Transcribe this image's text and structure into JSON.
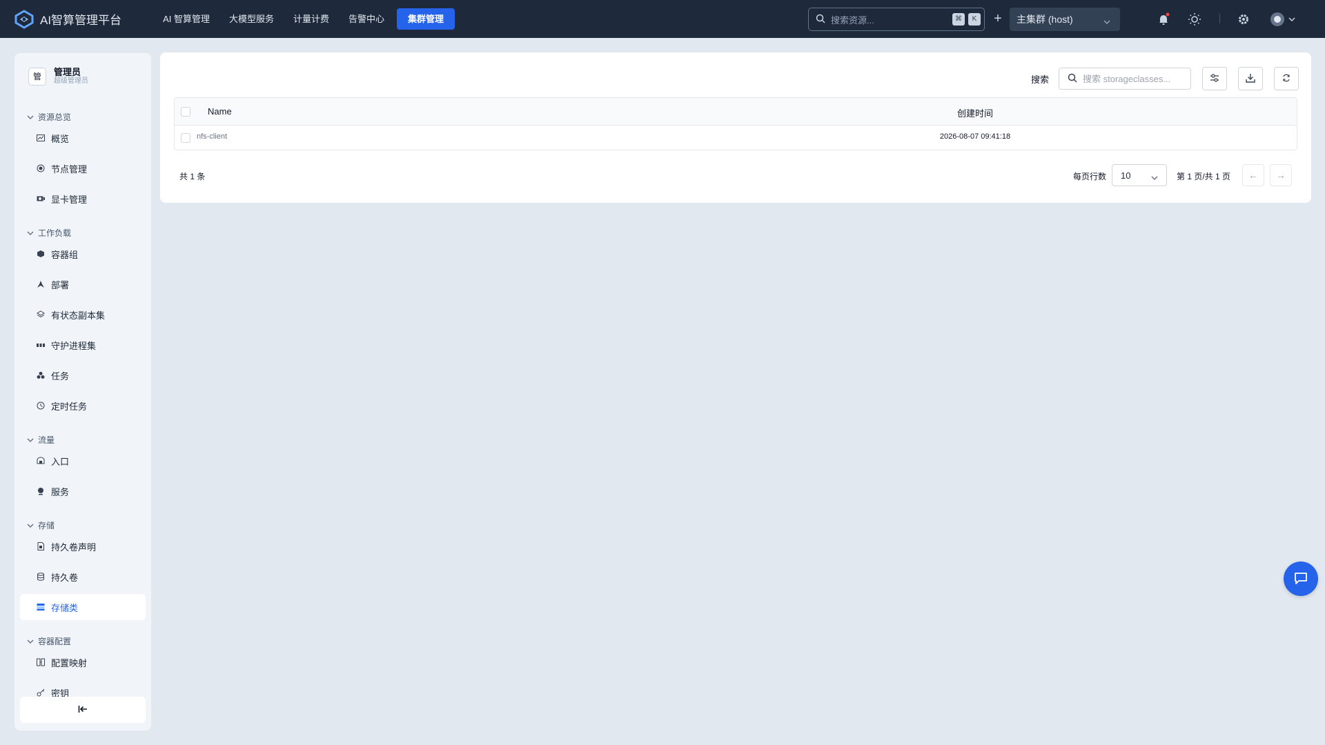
{
  "app": {
    "title": "AI智算管理平台"
  },
  "nav": {
    "items": [
      "AI 智算管理",
      "大模型服务",
      "计量计费",
      "告警中心"
    ],
    "active_label": "集群管理"
  },
  "search": {
    "placeholder": "搜索资源...",
    "kbd_1": "⌘",
    "kbd_2": "K"
  },
  "cluster": {
    "selected": "主集群 (host)"
  },
  "user": {
    "avatar_char": "管",
    "name": "管理员",
    "role": "超级管理员"
  },
  "sidebar": {
    "groups": [
      {
        "label": "资源总览",
        "items": [
          "概览",
          "节点管理",
          "显卡管理"
        ]
      },
      {
        "label": "工作负载",
        "items": [
          "容器组",
          "部署",
          "有状态副本集",
          "守护进程集",
          "任务",
          "定时任务"
        ]
      },
      {
        "label": "流量",
        "items": [
          "入口",
          "服务"
        ]
      },
      {
        "label": "存储",
        "items": [
          "持久卷声明",
          "持久卷",
          "存储类"
        ]
      },
      {
        "label": "容器配置",
        "items": [
          "配置映射",
          "密钥"
        ]
      }
    ],
    "active_item": "存储类"
  },
  "toolbar": {
    "search_label": "搜索",
    "search_placeholder": "搜索 storageclasses..."
  },
  "table": {
    "columns": [
      "Name",
      "创建时间"
    ],
    "rows": [
      {
        "name": "nfs-client",
        "created": "2026-08-07 09:41:18"
      }
    ]
  },
  "pagination": {
    "total": "共 1 条",
    "per_page_label": "每页行数",
    "per_page_value": "10",
    "page_info": "第 1 页/共 1 页",
    "prev": "←",
    "next": "→"
  },
  "colors": {
    "topbar": "#1e293b",
    "accent": "#2563eb",
    "background": "#e2e8f0",
    "notification_dot": "#ef4444"
  }
}
